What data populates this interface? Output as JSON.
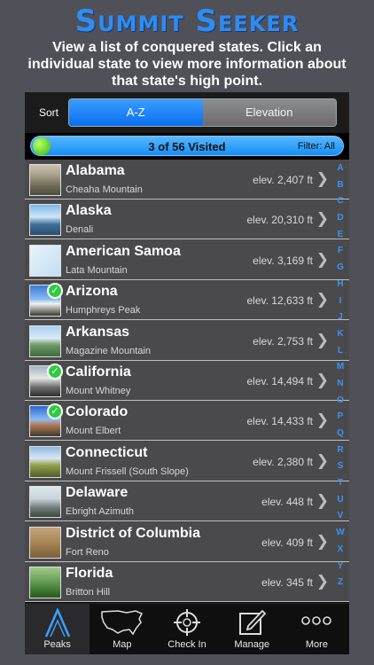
{
  "promo": {
    "title": "Summit Seeker",
    "subtitle": "View a list of conquered states. Click an individual state to view more information about that state's high point."
  },
  "sort": {
    "label": "Sort",
    "options": [
      "A-Z",
      "Elevation"
    ],
    "selected": "A-Z"
  },
  "progress": {
    "text": "3 of 56 Visited",
    "visited": 3,
    "total": 56,
    "filter": "Filter: All"
  },
  "states": [
    {
      "name": "Alabama",
      "peak": "Cheaha Mountain",
      "elev": "elev. 2,407 ft",
      "visited": false
    },
    {
      "name": "Alaska",
      "peak": "Denali",
      "elev": "elev. 20,310 ft",
      "visited": false
    },
    {
      "name": "American Samoa",
      "peak": "Lata Mountain",
      "elev": "elev. 3,169 ft",
      "visited": false
    },
    {
      "name": "Arizona",
      "peak": "Humphreys Peak",
      "elev": "elev. 12,633 ft",
      "visited": true
    },
    {
      "name": "Arkansas",
      "peak": "Magazine Mountain",
      "elev": "elev. 2,753 ft",
      "visited": false
    },
    {
      "name": "California",
      "peak": "Mount Whitney",
      "elev": "elev. 14,494 ft",
      "visited": true
    },
    {
      "name": "Colorado",
      "peak": "Mount Elbert",
      "elev": "elev. 14,433 ft",
      "visited": true
    },
    {
      "name": "Connecticut",
      "peak": "Mount Frissell (South Slope)",
      "elev": "elev. 2,380 ft",
      "visited": false
    },
    {
      "name": "Delaware",
      "peak": "Ebright Azimuth",
      "elev": "elev. 448 ft",
      "visited": false
    },
    {
      "name": "District of Columbia",
      "peak": "Fort Reno",
      "elev": "elev. 409 ft",
      "visited": false
    },
    {
      "name": "Florida",
      "peak": "Britton Hill",
      "elev": "elev. 345 ft",
      "visited": false
    }
  ],
  "index_letters": [
    "A",
    "B",
    "C",
    "D",
    "E",
    "F",
    "G",
    "H",
    "I",
    "J",
    "K",
    "L",
    "M",
    "N",
    "O",
    "P",
    "Q",
    "R",
    "S",
    "T",
    "U",
    "V",
    "W",
    "X",
    "Y",
    "Z"
  ],
  "tabs": [
    {
      "label": "Peaks",
      "icon": "peak-icon",
      "active": true
    },
    {
      "label": "Map",
      "icon": "us-map-icon",
      "active": false
    },
    {
      "label": "Check In",
      "icon": "crosshair-icon",
      "active": false
    },
    {
      "label": "Manage",
      "icon": "edit-icon",
      "active": false
    },
    {
      "label": "More",
      "icon": "more-dots-icon",
      "active": false
    }
  ],
  "colors": {
    "accent": "#2f8cf0",
    "background": "#505058",
    "check": "#2ecc40"
  }
}
